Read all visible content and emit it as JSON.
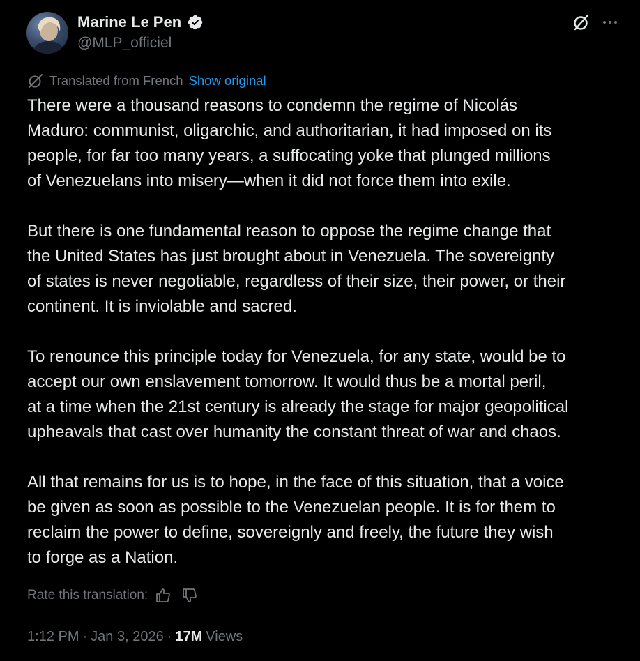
{
  "author": {
    "name": "Marine Le Pen",
    "handle": "@MLP_officiel",
    "verified_icon": "verified-badge-icon",
    "avatar_icon": "avatar"
  },
  "header_actions": {
    "grok_icon": "grok-icon",
    "more_icon": "more-icon"
  },
  "translation": {
    "label": "Translated from French",
    "show_original": "Show original",
    "icon": "translate-icon"
  },
  "tweet": {
    "paragraphs": [
      [
        "There were a thousand reasons to condemn the regime of Nicolás",
        "Maduro: communist, oligarchic, and authoritarian, it had imposed on its",
        "people, for far too many years, a suffocating yoke that plunged millions",
        "of Venezuelans into misery—when it did not force them into exile."
      ],
      [
        "But there is one fundamental reason to oppose the regime change that",
        "the United States has just brought about in Venezuela. The sovereignty",
        "of states is never negotiable, regardless of their size, their power, or their",
        "continent. It is inviolable and sacred."
      ],
      [
        "To renounce this principle today for Venezuela, for any state, would be to",
        "accept our own enslavement tomorrow. It would thus be a mortal peril,",
        "at a time when the 21st century is already the stage for major geopolitical",
        "upheavals that cast over humanity the constant threat of war and chaos."
      ],
      [
        "All that remains for us is to hope, in the face of this situation, that a voice",
        "be given as soon as possible to the Venezuelan people. It is for them to",
        "reclaim the power to define, sovereignly and freely, the future they wish",
        "to forge as a Nation."
      ]
    ]
  },
  "rating": {
    "label": "Rate this translation:",
    "thumbs_up_icon": "thumbs-up-icon",
    "thumbs_down_icon": "thumbs-down-icon"
  },
  "meta": {
    "time": "1:12 PM",
    "separator": "·",
    "date": "Jan 3, 2026",
    "views_count": "17M",
    "views_label": "Views"
  },
  "colors": {
    "background": "#000000",
    "text_primary": "#e7e9ea",
    "text_secondary": "#71767b",
    "accent_blue": "#1d9bf0",
    "border": "#2f3336"
  }
}
